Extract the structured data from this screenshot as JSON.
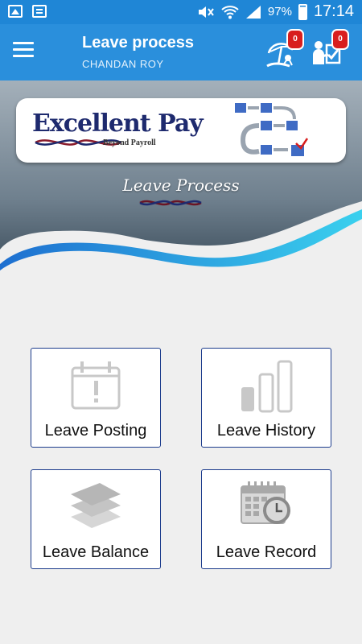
{
  "status_bar": {
    "battery": "97%",
    "time": "17:14",
    "icons": [
      "image-icon",
      "card-icon",
      "mute-icon",
      "wifi-icon",
      "signal-icon",
      "battery-icon"
    ]
  },
  "header": {
    "title": "Leave process",
    "user": "CHANDAN ROY",
    "notifications": [
      {
        "icon": "holiday-umbrella-icon",
        "count": "0"
      },
      {
        "icon": "approval-person-icon",
        "count": "0"
      }
    ]
  },
  "banner": {
    "logo_text": "Excellent Pay",
    "logo_tagline": "Beyond Payroll",
    "caption": "Leave Process"
  },
  "tiles": [
    {
      "label": "Leave Posting",
      "icon": "calendar-alert-icon"
    },
    {
      "label": "Leave History",
      "icon": "bar-chart-icon"
    },
    {
      "label": "Leave Balance",
      "icon": "layers-icon"
    },
    {
      "label": "Leave Record",
      "icon": "calendar-clock-icon"
    }
  ],
  "colors": {
    "primary": "#2a8fdc",
    "status_bar": "#1f86d6",
    "tile_border": "#1c3c8c",
    "badge": "#d81e1e",
    "background": "#efefef"
  }
}
